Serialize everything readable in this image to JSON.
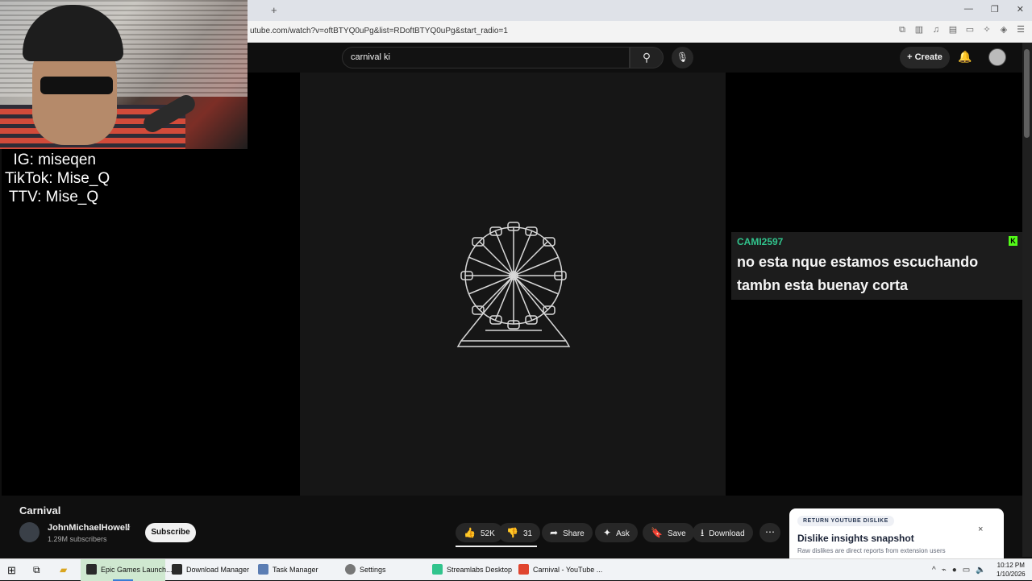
{
  "browser": {
    "url": "utube.com/watch?v=oftBTYQ0uPg&list=RDoftBTYQ0uPg&start_radio=1",
    "newtab": "+",
    "window_controls": [
      "—",
      "❐",
      "✕"
    ]
  },
  "youtube": {
    "search_value": "carnival ki",
    "create_label": "Create"
  },
  "stream_overlay": {
    "socials": [
      "  IG: miseqen",
      "TikTok: Mise_Q",
      " TTV: Mise_Q"
    ],
    "chat_user": "CAMI2597",
    "chat_badge": "K",
    "chat_message": "no esta nque estamos escuchando tambn esta buenay corta"
  },
  "video_info": {
    "title": "Carnival",
    "channel": "JohnMichaelHowell",
    "subscribers": "1.29M subscribers",
    "subscribe_label": "Subscribe",
    "likes": "52K",
    "dislikes": "31",
    "share_label": "Share",
    "ask_label": "Ask",
    "save_label": "Save",
    "download_label": "Download",
    "more_label": "⋯"
  },
  "ryd_panel": {
    "tag": "RETURN YOUTUBE DISLIKE",
    "title": "Dislike insights snapshot",
    "subtitle": "Raw dislikes are direct reports from extension users",
    "close": "×"
  },
  "taskbar": {
    "items": [
      {
        "label": "Epic Games Launch...",
        "color": "#2a2a2a"
      },
      {
        "label": "Download Manager",
        "color": "#2a2a2a"
      },
      {
        "label": "Task Manager",
        "color": "#5b7db3"
      },
      {
        "label": "Settings",
        "color": "#555"
      },
      {
        "label": "Streamlabs Desktop",
        "color": "#31c48d"
      },
      {
        "label": "Carnival - YouTube ...",
        "color": "#e0452f"
      }
    ],
    "time": "10:12 PM",
    "date": "1/10/2026"
  }
}
